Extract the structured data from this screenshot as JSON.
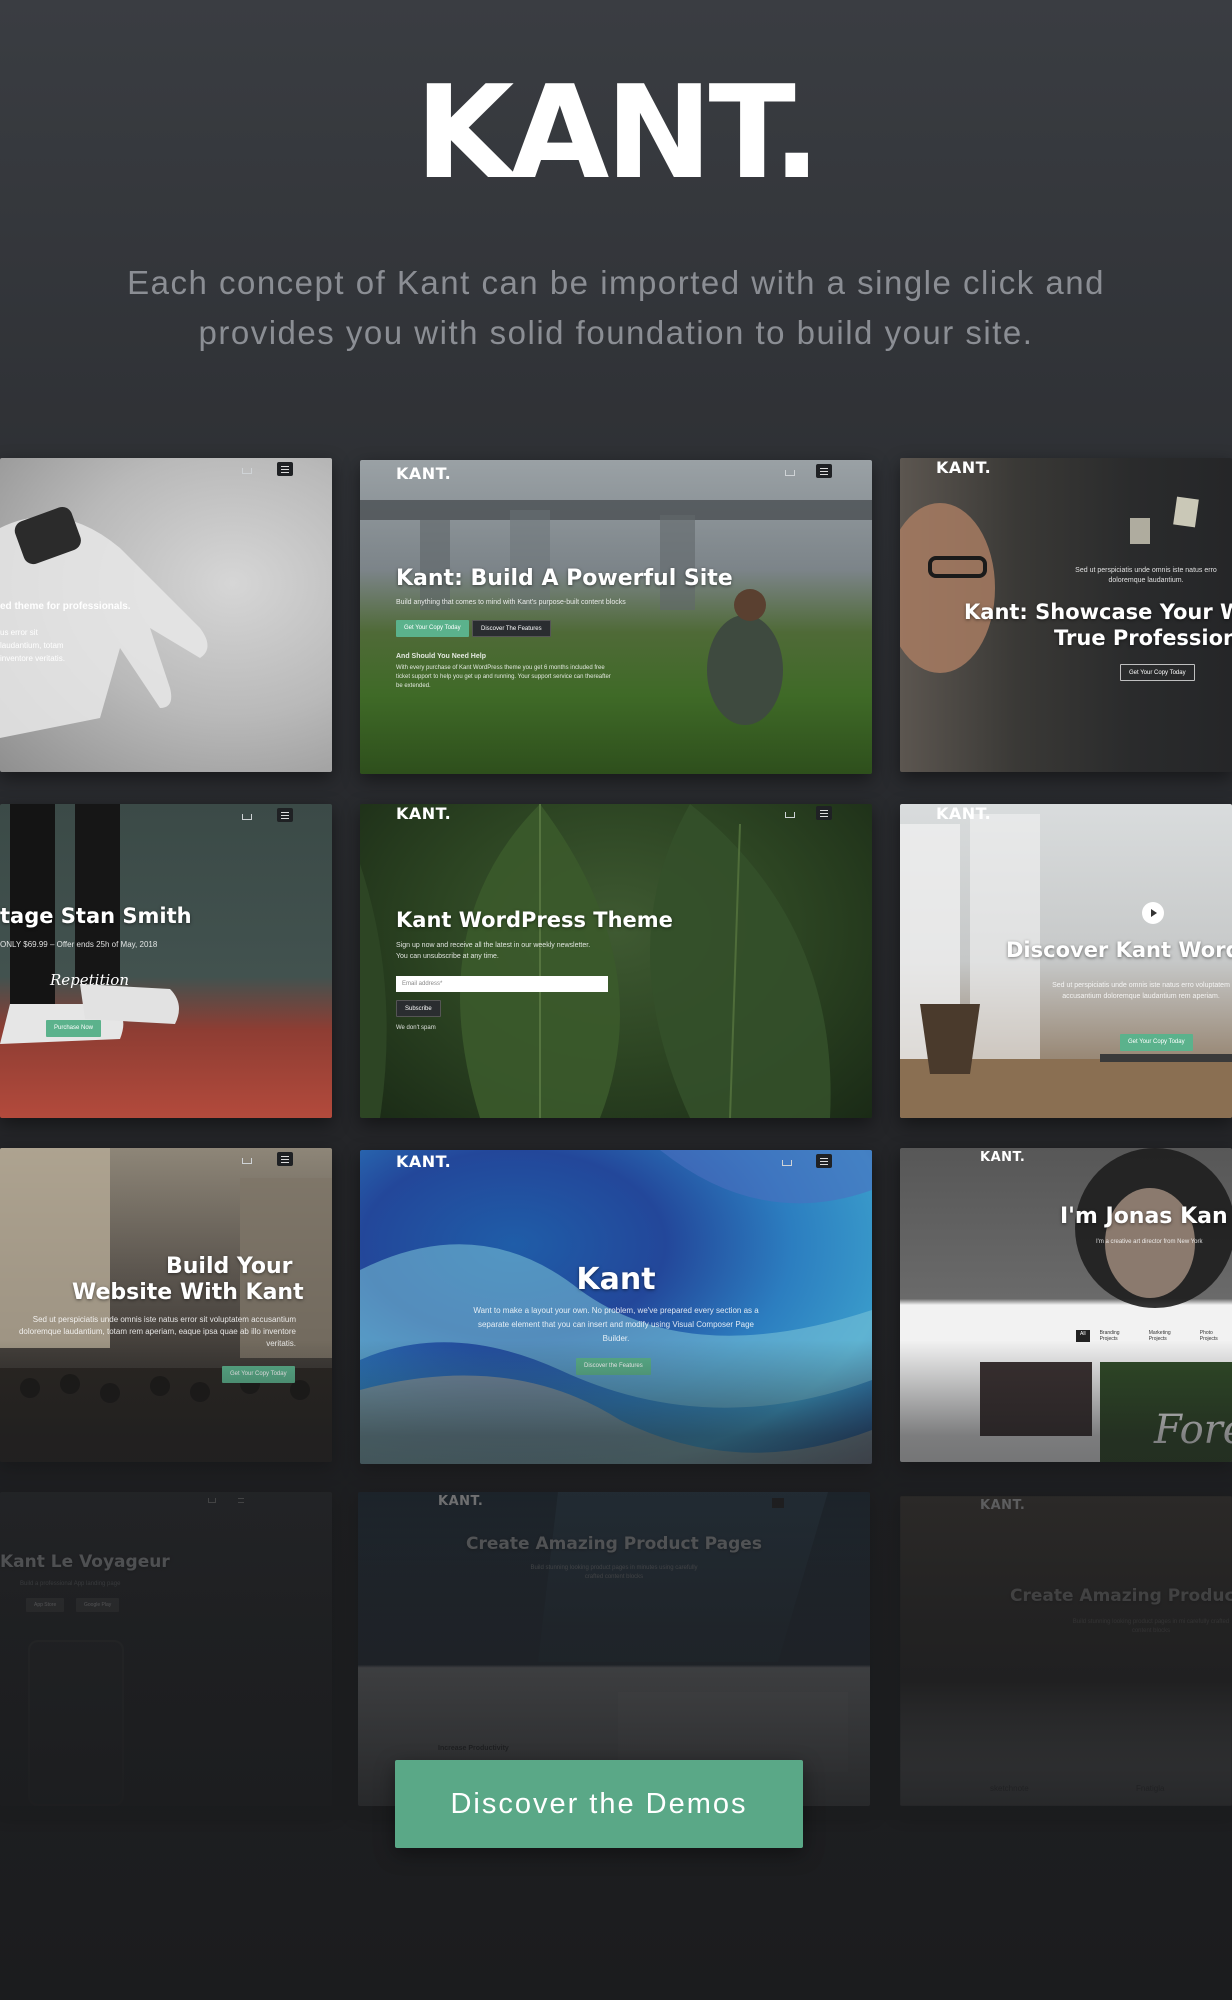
{
  "hero": {
    "logo": "KANT.",
    "tagline_line1": "Each concept of Kant can be imported with a single click and",
    "tagline_line2": "provides you with solid foundation to build your site."
  },
  "demos": [
    {
      "id": "watch",
      "heading": "",
      "text": "ed theme for professionals.",
      "text2": "us error sit laudantium, totam inventore veritatis."
    },
    {
      "id": "powerful-site",
      "brand": "KANT.",
      "heading": "Kant: Build A Powerful Site",
      "text": "Build anything that comes to mind with Kant's purpose-built content blocks",
      "btn1": "Get Your Copy Today",
      "btn2": "Discover The Features",
      "subheading": "And Should You Need Help",
      "text2": "With every purchase of Kant WordPress theme you get 6 months included free ticket support to help you get up and running. Your support service can thereafter be extended."
    },
    {
      "id": "showcase",
      "brand": "KANT.",
      "heading": "Kant: Showcase Your W",
      "heading2": "True Profession",
      "text": "Sed ut perspiciatis unde omnis iste natus erro doloremque laudantium.",
      "btn1": "Get Your Copy Today"
    },
    {
      "id": "stan-smith",
      "heading": "tage Stan Smith",
      "text": "ONLY $69.99 – Offer ends 25h of May, 2018",
      "script": "Repetition",
      "btn1": "Purchase Now"
    },
    {
      "id": "wordpress-theme",
      "brand": "KANT.",
      "heading": "Kant WordPress Theme",
      "text": "Sign up now and receive all the latest in our weekly newsletter. You can unsubscribe at any time.",
      "input": "Email address*",
      "btn1": "Subscribe",
      "text2": "We don't spam"
    },
    {
      "id": "discover-word",
      "brand": "KANT.",
      "heading": "Discover Kant Word",
      "text": "Sed ut perspiciatis unde omnis iste natus erro voluptatem accusantium doloremque laudantium rem aperiam.",
      "btn1": "Get Your Copy Today"
    },
    {
      "id": "build-website",
      "heading": "Build Your",
      "heading2": "Website With Kant",
      "text": "Sed ut perspiciatis unde omnis iste natus error sit voluptatem accusantium doloremque laudantium, totam rem aperiam, eaque ipsa quae ab illo inventore veritatis.",
      "btn1": "Get Your Copy Today"
    },
    {
      "id": "kant-fluid",
      "brand": "KANT.",
      "heading": "Kant",
      "text": "Want to make a layout your own. No problem, we've prepared every section as a separate element that you can insert and modify using Visual Composer Page Builder.",
      "btn1": "Discover the Features"
    },
    {
      "id": "jonas",
      "brand": "KANT.",
      "heading": "I'm Jonas Kan",
      "text": "I'm a creative art director from New York",
      "filters": [
        "All",
        "Branding Projects",
        "Marketing Projects",
        "Photo Projects"
      ],
      "script": "Fore"
    },
    {
      "id": "voyageur",
      "heading": "Kant Le Voyageur",
      "text": "Build a professional App landing page",
      "btn1": "App Store",
      "btn2": "Google Play"
    },
    {
      "id": "product-pages",
      "brand": "KANT.",
      "heading": "Create Amazing Product Pages",
      "text": "Build stunning looking product pages in minutes using carefully crafted content blocks",
      "subheading": "Increase Productivity"
    },
    {
      "id": "product-pages-2",
      "brand": "KANT.",
      "heading": "Create Amazing Produc",
      "text": "Build stunning looking product pages in mi carefully crafted content blocks",
      "footer": [
        "sketchnote",
        "Fnatigla"
      ]
    }
  ],
  "cta": {
    "label": "Discover the Demos"
  },
  "colors": {
    "accent": "#5aa887",
    "background": "#232427"
  }
}
